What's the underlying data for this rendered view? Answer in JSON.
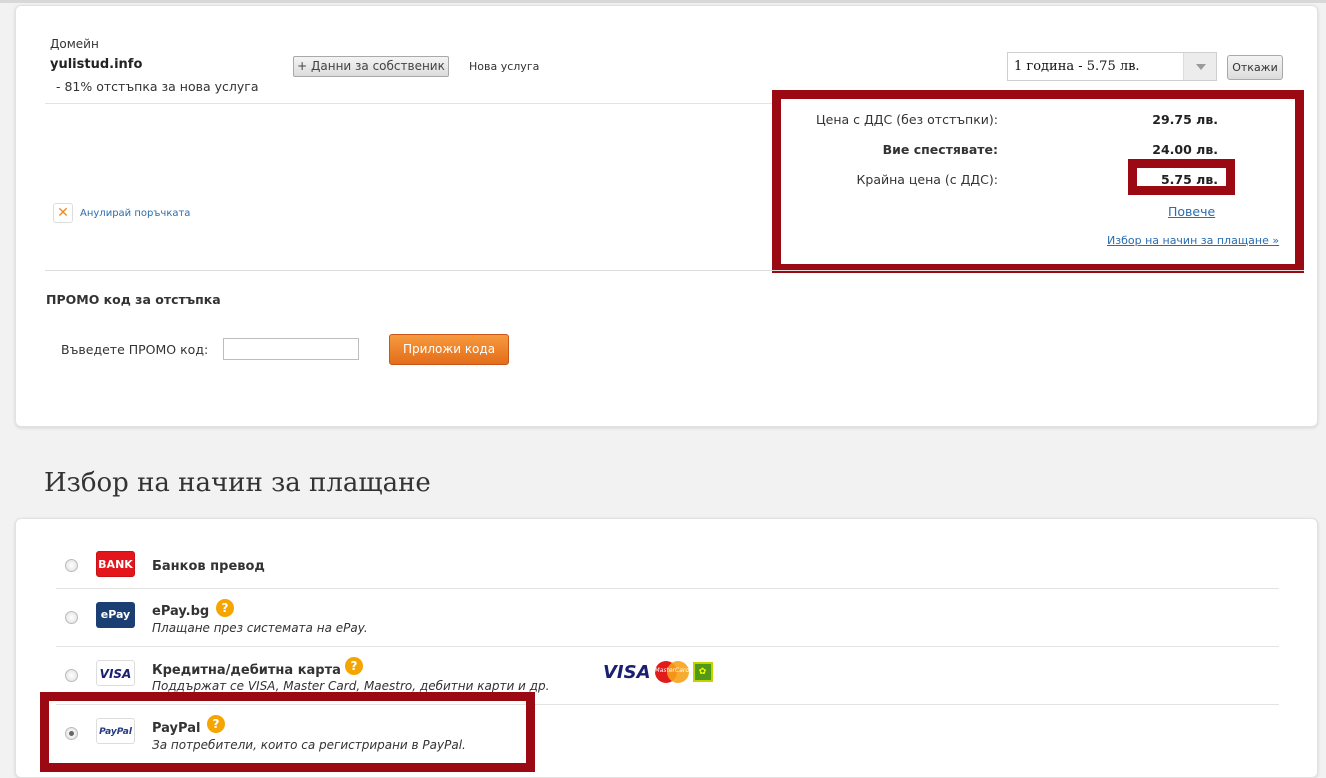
{
  "order": {
    "item_type_label": "Домейн",
    "domain_name": "yulistud.info",
    "discount_note": "- 81% отстъпка за нова услуга",
    "owner_data_button": "+ Данни за собственик",
    "service_status": "Нова услуга",
    "period_select": "1 година - 5.75 лв.",
    "cancel_button": "Откажи",
    "cancel_order_link": "Анулирай поръчката"
  },
  "summary": {
    "price_label": "Цена с ДДС (без отстъпки):",
    "price_value": "29.75 лв.",
    "savings_label": "Вие спестявате:",
    "savings_value": "24.00 лв.",
    "final_label": "Крайна цена (с ДДС):",
    "final_value": "5.75 лв.",
    "more_link": "Повече",
    "choose_payment_link": "Избор на начин за плащане »"
  },
  "promo": {
    "title": "ПРОМО код за отстъпка",
    "input_label": "Въведете ПРОМО код:",
    "input_value": "",
    "apply_button": "Приложи кода"
  },
  "payment": {
    "section_title": "Избор на начин за плащане",
    "methods": [
      {
        "logo": "BANK",
        "title": "Банков превод",
        "description": "",
        "selected": false
      },
      {
        "logo": "ePay",
        "title": "ePay.bg",
        "description": "Плащане през системата на ePay.",
        "selected": false
      },
      {
        "logo": "VISA",
        "title": "Кредитна/дебитна карта",
        "description": "Поддържат се VISA, Master Card, Maestro, дебитни карти и др.",
        "selected": false
      },
      {
        "logo": "PayPal",
        "title": "PayPal",
        "description": "За потребители, които са регистрирани в PayPal.",
        "selected": true
      }
    ],
    "card_logos": {
      "visa": "VISA",
      "mastercard": "MasterCard",
      "borica": "BORICA"
    },
    "help_glyph": "?"
  },
  "colors": {
    "highlight_border": "#9b0a12",
    "accent_orange": "#e36d1a",
    "link_blue": "#2a6db0"
  }
}
